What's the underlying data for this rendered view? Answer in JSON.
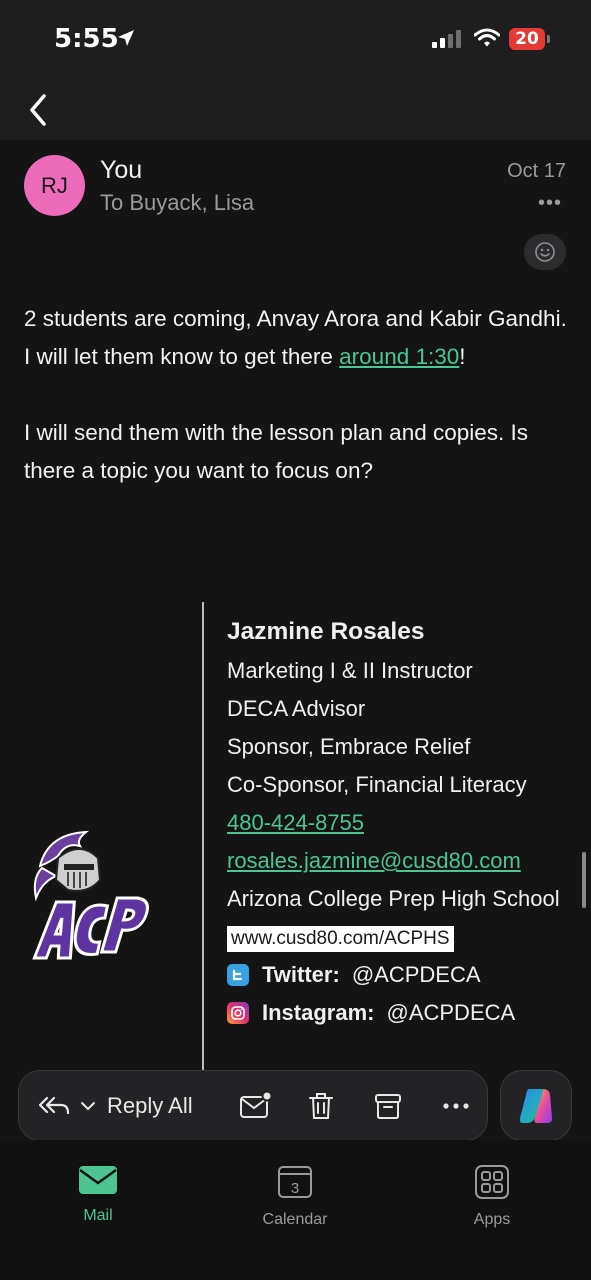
{
  "status_bar": {
    "time": "5:55",
    "battery": "20",
    "icons": [
      "location-arrow-icon",
      "signal-icon",
      "wifi-icon",
      "battery-icon"
    ]
  },
  "nav": {
    "back_icon": "chevron-left-icon"
  },
  "email": {
    "avatar_initials": "RJ",
    "sender": "You",
    "recipients": "To Buyack, Lisa",
    "date": "Oct 17",
    "more": "•••",
    "body": {
      "p1_before": "2 students are coming, Anvay Arora and Kabir Gandhi. I will let them know to get there ",
      "p1_link": "around 1:30",
      "p1_after": "!",
      "p2": "I will send them with the lesson plan and copies. Is there a topic you want to focus on?"
    },
    "signature": {
      "name": "Jazmine Rosales",
      "lines": [
        "Marketing I & II Instructor",
        "DECA Advisor",
        "Sponsor, Embrace Relief",
        "Co-Sponsor, Financial Literacy"
      ],
      "phone": "480-424-8755",
      "email": "rosales.jazmine@cusd80.com",
      "school": "Arizona College Prep High School",
      "website": "www.cusd80.com/ACPHS",
      "twitter_label": "Twitter:",
      "twitter_handle": "@ACPDECA",
      "instagram_label": "Instagram:",
      "instagram_handle": "@ACPDECA",
      "logo_text": "ACP"
    }
  },
  "actions": {
    "reply_label": "Reply All"
  },
  "tabs": [
    {
      "label": "Mail",
      "active": true
    },
    {
      "label": "Calendar",
      "day": "3",
      "active": false
    },
    {
      "label": "Apps",
      "active": false
    }
  ],
  "colors": {
    "accent": "#4dc591",
    "avatar": "#ec6cb9",
    "battery": "#e53935",
    "background": "#141414"
  }
}
